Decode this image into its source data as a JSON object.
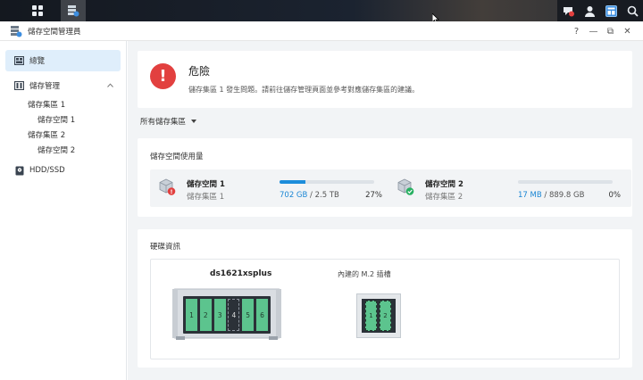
{
  "window": {
    "title": "儲存空間管理員",
    "controls": [
      "?",
      "—",
      "⧉",
      "✕"
    ]
  },
  "sidebar": {
    "items": [
      {
        "label": "總覽",
        "icon": "overview-icon",
        "selected": true
      },
      {
        "label": "儲存管理",
        "icon": "storage-manager-icon",
        "expanded": true
      },
      {
        "label": "儲存集區 1"
      },
      {
        "label": "儲存空間 1"
      },
      {
        "label": "儲存集區 2"
      },
      {
        "label": "儲存空間 2"
      },
      {
        "label": "HDD/SSD",
        "icon": "drive-icon"
      }
    ]
  },
  "alert": {
    "status": "危險",
    "message": "儲存集區 1 發生問題。請前往儲存管理頁面並參考對應儲存集區的建議。"
  },
  "filter": {
    "label": "所有儲存集區"
  },
  "usage": {
    "title": "儲存空間使用量",
    "volumes": [
      {
        "name": "儲存空間 1",
        "pool": "儲存集區 1",
        "used": "702 GB",
        "total": " / 2.5 TB",
        "percent_text": "27%",
        "fill": 0.27,
        "status": "error",
        "status_color": "#e2403f"
      },
      {
        "name": "儲存空間 2",
        "pool": "儲存集區 2",
        "used": "17 MB",
        "total": " / 889.8 GB",
        "percent_text": "0%",
        "fill": 0.0,
        "status": "healthy",
        "status_color": "#27b061"
      }
    ]
  },
  "hardware": {
    "title": "硬碟資訊",
    "device": "ds1621xsplus",
    "bays": [
      "1",
      "2",
      "3",
      "4",
      "5",
      "6"
    ],
    "empty_bay": "4",
    "m2_label": "內建的 M.2 插槽",
    "m2_slots": [
      "1",
      "2"
    ]
  },
  "colors": {
    "accent": "#1c8ddb",
    "danger": "#e2403f",
    "ok": "#27b061",
    "bay": "#5cc48e"
  }
}
